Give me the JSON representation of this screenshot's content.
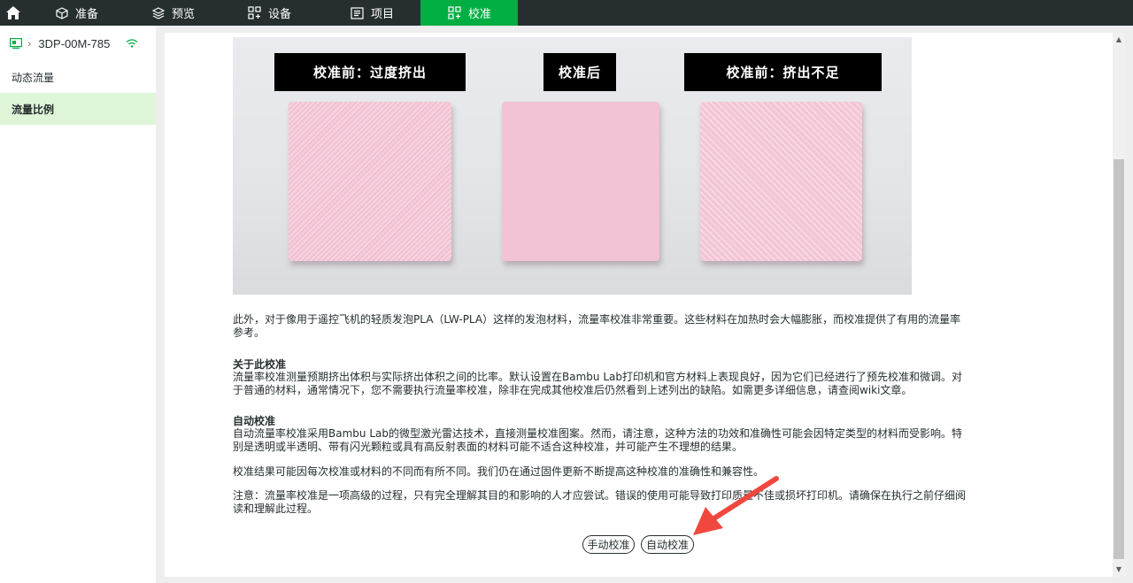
{
  "topbar": {
    "tabs": [
      {
        "label": "准备",
        "icon": "cube-icon"
      },
      {
        "label": "预览",
        "icon": "layers-icon"
      },
      {
        "label": "设备",
        "icon": "device-icon"
      },
      {
        "label": "项目",
        "icon": "list-icon"
      },
      {
        "label": "校准",
        "icon": "calibration-icon",
        "active": true
      }
    ]
  },
  "sidebar": {
    "device_name": "3DP-00M-785",
    "items": [
      {
        "label": "动态流量"
      },
      {
        "label": "流量比例",
        "active": true
      }
    ]
  },
  "photo": {
    "labels": [
      "校准前：过度挤出",
      "校准后",
      "校准前：挤出不足"
    ]
  },
  "content": {
    "intro": "此外，对于像用于遥控飞机的轻质发泡PLA（LW-PLA）这样的发泡材料，流量率校准非常重要。这些材料在加热时会大幅膨胀，而校准提供了有用的流量率参考。",
    "about_title": "关于此校准",
    "about_body": "流量率校准测量预期挤出体积与实际挤出体积之间的比率。默认设置在Bambu Lab打印机和官方材料上表现良好，因为它们已经进行了预先校准和微调。对于普通的材料，通常情况下，您不需要执行流量率校准，除非在完成其他校准后仍然看到上述列出的缺陷。如需更多详细信息，请查阅wiki文章。",
    "auto_title": "自动校准",
    "auto_body": "自动流量率校准采用Bambu Lab的微型激光雷达技术，直接测量校准图案。然而，请注意，这种方法的功效和准确性可能会因特定类型的材料而受影响。特别是透明或半透明、带有闪光颗粒或具有高反射表面的材料可能不适合这种校准，并可能产生不理想的结果。",
    "result_note": "校准结果可能因每次校准或材料的不同而有所不同。我们仍在通过固件更新不断提高这种校准的准确性和兼容性。",
    "warning": "注意：流量率校准是一项高级的过程，只有完全理解其目的和影响的人才应尝试。错误的使用可能导致打印质量不佳或损坏打印机。请确保在执行之前仔细阅读和理解此过程。"
  },
  "buttons": {
    "manual": "手动校准",
    "auto": "自动校准"
  },
  "colors": {
    "topbar_bg": "#262e30",
    "accent": "#00ae42",
    "sidebar_active": "#dff5d8",
    "annotation_arrow": "#f0483e"
  }
}
